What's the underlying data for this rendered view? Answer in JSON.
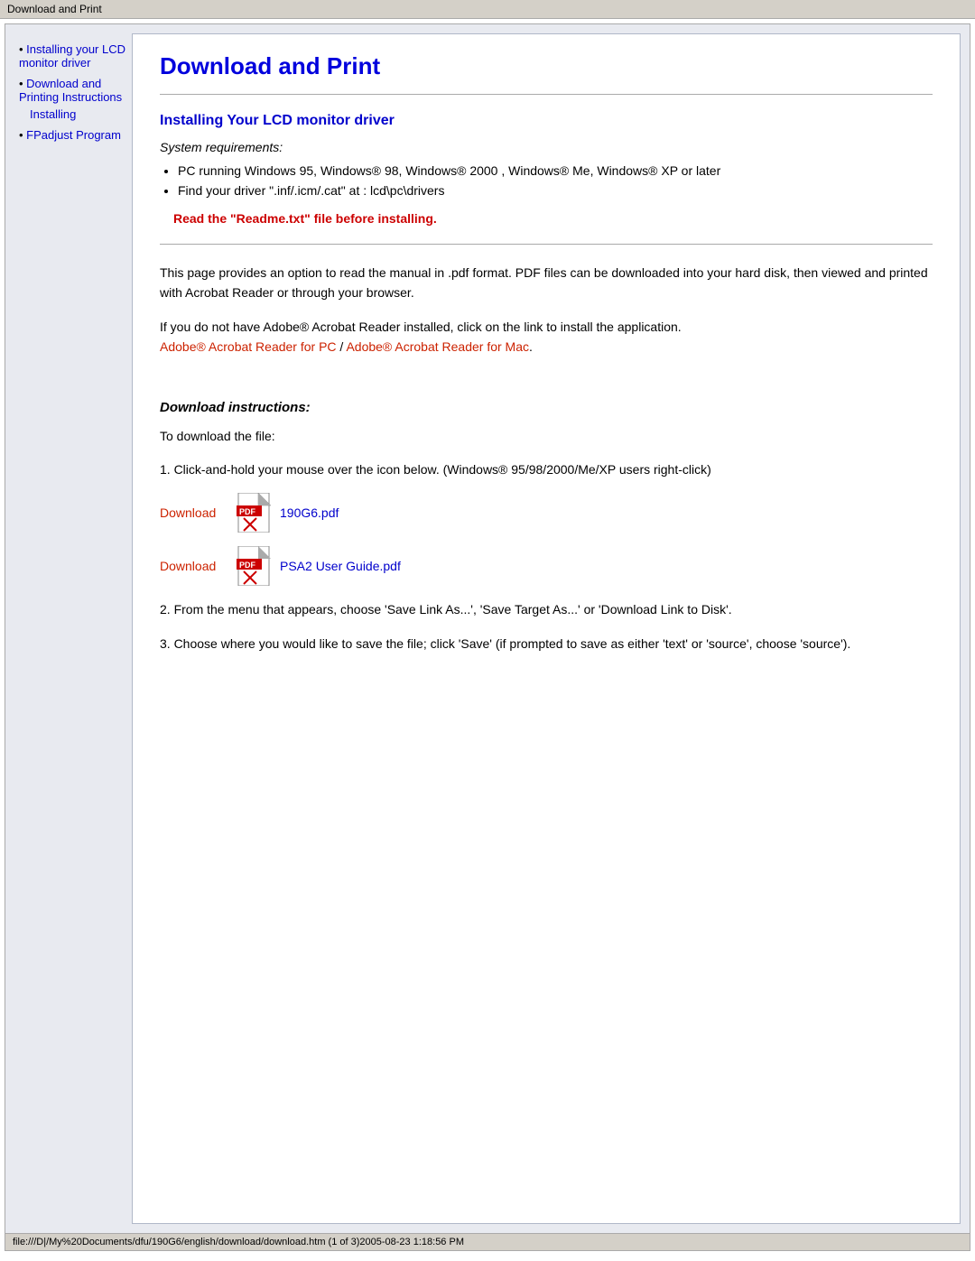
{
  "titleBar": {
    "text": "Download and Print"
  },
  "sidebar": {
    "items": [
      {
        "label": "Installing your LCD monitor driver",
        "href": "#install"
      },
      {
        "label": "Download and Printing Instructions Installing",
        "href": "#download"
      },
      {
        "label": "FPadjust Program",
        "href": "#fpadjust"
      }
    ]
  },
  "page": {
    "title": "Download and Print",
    "sectionTitle": "Installing Your LCD monitor driver",
    "systemReqLabel": "System requirements:",
    "bulletItems": [
      "PC running Windows 95, Windows® 98, Windows® 2000 , Windows® Me, Windows® XP or later",
      "Find your driver \".inf/.icm/.cat\" at : lcd\\pc\\drivers"
    ],
    "warningText": "Read the \"Readme.txt\" file before installing.",
    "bodyText1": "This page provides an option to read the manual in .pdf format. PDF files can be downloaded into your hard disk, then viewed and printed with Acrobat Reader or through your browser.",
    "bodyText2": "If you do not have Adobe® Acrobat Reader installed, click on the link to install the application.",
    "acrobatLinkPC": "Adobe® Acrobat Reader for PC",
    "acrobatLinkSeparator": " / ",
    "acrobatLinkMac": "Adobe® Acrobat Reader for Mac",
    "downloadInstructionsTitle": "Download instructions:",
    "downloadIntro": "To download the file:",
    "step1": "1. Click-and-hold your mouse over the icon below. (Windows® 95/98/2000/Me/XP users right-click)",
    "downloadLinks": [
      {
        "label": "Download",
        "filename": "190G6.pdf"
      },
      {
        "label": "Download",
        "filename": "PSA2 User Guide.pdf"
      }
    ],
    "step2": "2. From the menu that appears, choose 'Save Link As...', 'Save Target As...' or 'Download Link to Disk'.",
    "step3": "3. Choose where you would like to save the file; click 'Save' (if prompted to save as either 'text' or 'source', choose 'source')."
  },
  "statusBar": {
    "text": "file:///D|/My%20Documents/dfu/190G6/english/download/download.htm (1 of 3)2005-08-23 1:18:56 PM"
  }
}
